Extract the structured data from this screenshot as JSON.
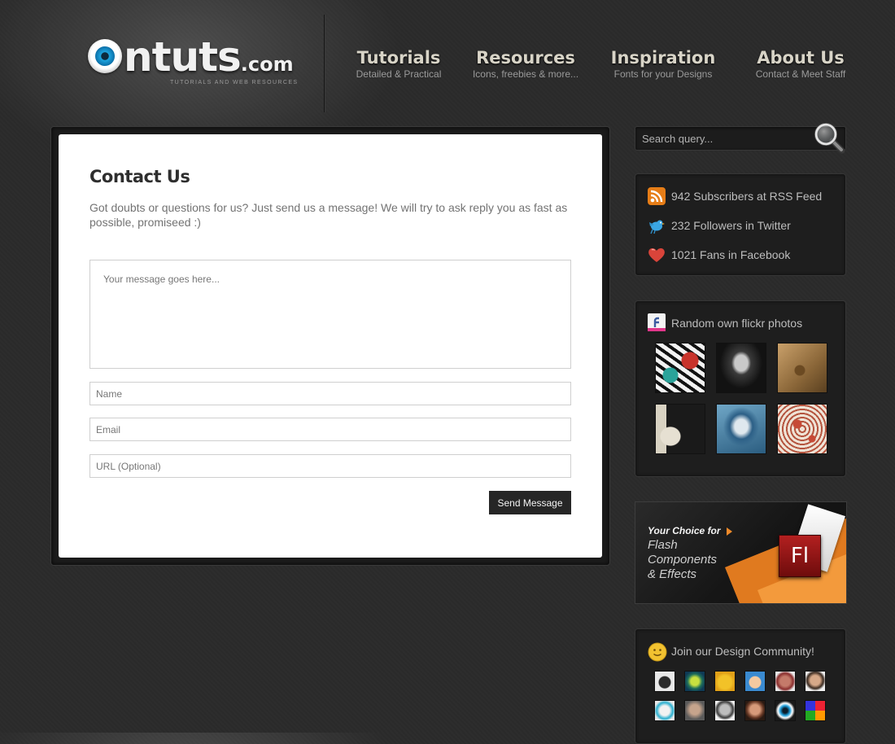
{
  "header": {
    "logo_text": "ntuts",
    "logo_suffix": ".com",
    "logo_tagline": "TUTORIALS AND WEB RESOURCES",
    "nav": [
      {
        "title": "Tutorials",
        "subtitle": "Detailed & Practical"
      },
      {
        "title": "Resources",
        "subtitle": "Icons, freebies & more..."
      },
      {
        "title": "Inspiration",
        "subtitle": "Fonts for your Designs"
      },
      {
        "title": "About Us",
        "subtitle": "Contact & Meet Staff"
      }
    ]
  },
  "contact": {
    "title": "Contact Us",
    "intro": "Got doubts or questions for us? Just send us a message! We will try to ask reply you as fast as possible, promiseed :)",
    "message_placeholder": "Your message goes here...",
    "name_placeholder": "Name",
    "email_placeholder": "Email",
    "url_placeholder": "URL (Optional)",
    "send_label": "Send Message"
  },
  "sidebar": {
    "search_placeholder": "Search query...",
    "stats": [
      {
        "icon": "rss-icon",
        "text": "942 Subscribers at RSS Feed"
      },
      {
        "icon": "twitter-bird-icon",
        "text": "232 Followers in Twitter"
      },
      {
        "icon": "heart-icon",
        "text": "1021 Fans in Facebook"
      }
    ],
    "flickr_title": "Random own flickr photos",
    "ad": {
      "heading": "Your Choice for",
      "lines": [
        "Flash",
        "Components",
        "& Effects"
      ],
      "logo_text": "Fl"
    },
    "community_title": "Join our Design Community!"
  },
  "colors": {
    "background": "#2b2b2b",
    "card": "#ffffff",
    "button": "#262626",
    "nav_title": "#d8d4c7",
    "ad_accent": "#e07a1f"
  }
}
